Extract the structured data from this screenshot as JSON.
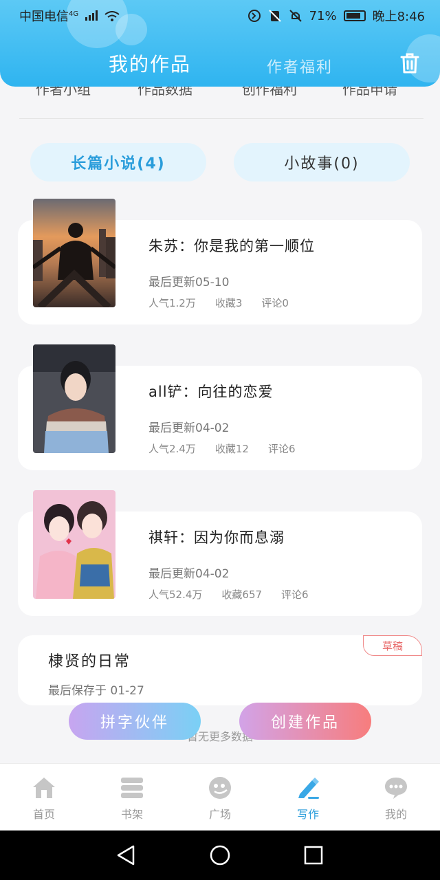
{
  "status_bar": {
    "carrier": "中国电信",
    "network": "4G",
    "battery": "71%",
    "time": "晚上8:46"
  },
  "header": {
    "title": "我的作品",
    "secondary_tab": "作者福利",
    "trash_icon": "trash-icon"
  },
  "subnav": [
    "作者小组",
    "作品数据",
    "创作福利",
    "作品申请"
  ],
  "tabs": [
    {
      "label": "长篇小说(4)",
      "active": true
    },
    {
      "label": "小故事(0)",
      "active": false
    }
  ],
  "works": [
    {
      "title": "朱苏：你是我的第一顺位",
      "updated": "最后更新05-10",
      "popularity": "人气1.2万",
      "favorites": "收藏3",
      "comments": "评论0"
    },
    {
      "title": "all铲：向往的恋爱",
      "updated": "最后更新04-02",
      "popularity": "人气2.4万",
      "favorites": "收藏12",
      "comments": "评论6"
    },
    {
      "title": "祺轩：因为你而息溺",
      "updated": "最后更新04-02",
      "popularity": "人气52.4万",
      "favorites": "收藏657",
      "comments": "评论6"
    }
  ],
  "draft": {
    "title": "棣贤的日常",
    "saved": "最后保存于 01-27",
    "badge": "草稿"
  },
  "no_more": "暂无更多数据",
  "buttons": {
    "partner": "拼字伙伴",
    "create": "创建作品"
  },
  "bottom_nav": [
    {
      "label": "首页",
      "icon": "home-icon",
      "active": false
    },
    {
      "label": "书架",
      "icon": "bookshelf-icon",
      "active": false
    },
    {
      "label": "广场",
      "icon": "plaza-icon",
      "active": false
    },
    {
      "label": "写作",
      "icon": "write-icon",
      "active": true
    },
    {
      "label": "我的",
      "icon": "chat-icon",
      "active": false
    }
  ],
  "colors": {
    "header": "#2fb4f0",
    "accent": "#2a9ddb",
    "tab_bg": "#e3f4fd",
    "draft_badge": "#e86a6a"
  }
}
